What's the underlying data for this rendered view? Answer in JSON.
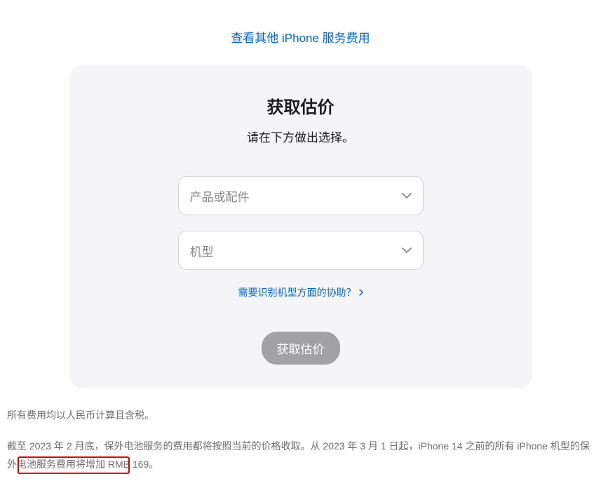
{
  "topLink": {
    "label": "查看其他 iPhone 服务费用"
  },
  "card": {
    "title": "获取估价",
    "subtitle": "请在下方做出选择。",
    "select1": {
      "placeholder": "产品或配件"
    },
    "select2": {
      "placeholder": "机型"
    },
    "helpLink": "需要识别机型方面的协助？",
    "submit": "获取估价"
  },
  "footnotes": {
    "line1": "所有费用均以人民币计算且含税。",
    "line2": "截至 2023 年 2 月底，保外电池服务的费用都将按照当前的价格收取。从 2023 年 3 月 1 日起，iPhone 14 之前的所有 iPhone 机型的保外电池服务费用将增加 RMB 169。"
  }
}
